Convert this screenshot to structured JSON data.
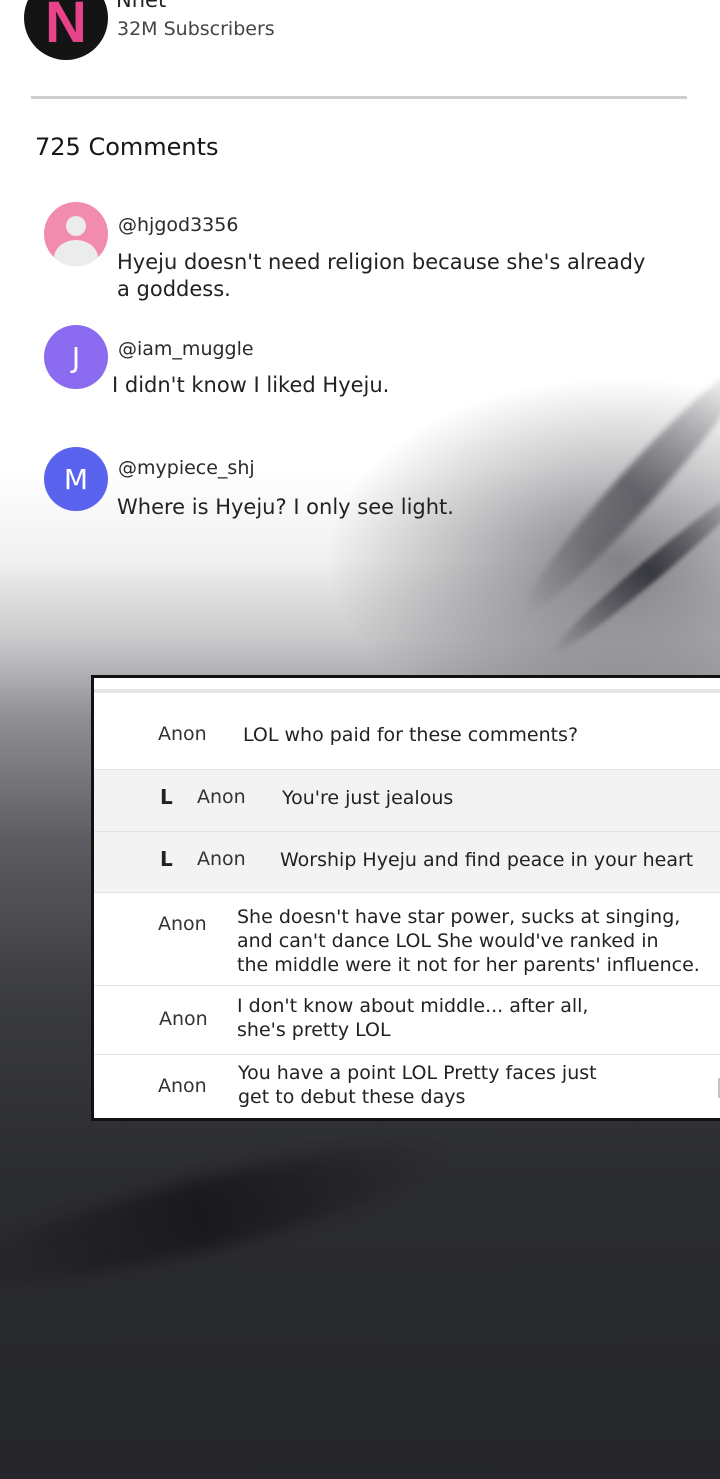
{
  "channel": {
    "logo_letter": "N",
    "name": "Nnet",
    "subscribers": "32M Subscribers"
  },
  "comments_header": "725 Comments",
  "comments": [
    {
      "avatar_type": "person-icon",
      "avatar_color": "#f28cae",
      "handle": "@hjgod3356",
      "text": "Hyeju doesn't need religion because she's already\na goddess."
    },
    {
      "avatar_letter": "J",
      "avatar_color": "#8b6cf0",
      "handle": "@iam_muggle",
      "text": "I didn't know I liked Hyeju."
    },
    {
      "avatar_letter": "M",
      "avatar_color": "#5a63ee",
      "handle": "@mypiece_shj",
      "text": "Where is Hyeju? I only see light."
    }
  ],
  "thread": [
    {
      "author": "Anon",
      "reply": false,
      "text": "LOL who paid for these comments?"
    },
    {
      "author": "Anon",
      "reply": true,
      "reply_mark": "L",
      "text": "You're just jealous"
    },
    {
      "author": "Anon",
      "reply": true,
      "reply_mark": "L",
      "text": "Worship Hyeju and find peace in your heart"
    },
    {
      "author": "Anon",
      "reply": false,
      "text": "She doesn't have star power, sucks at singing,\nand can't dance LOL She would've ranked in\nthe middle were it not for her parents' influence."
    },
    {
      "author": "Anon",
      "reply": false,
      "text": "I don't know about middle... after all,\nshe's pretty LOL"
    },
    {
      "author": "Anon",
      "reply": false,
      "text": "You have a point LOL Pretty faces just\nget to debut these days"
    }
  ]
}
